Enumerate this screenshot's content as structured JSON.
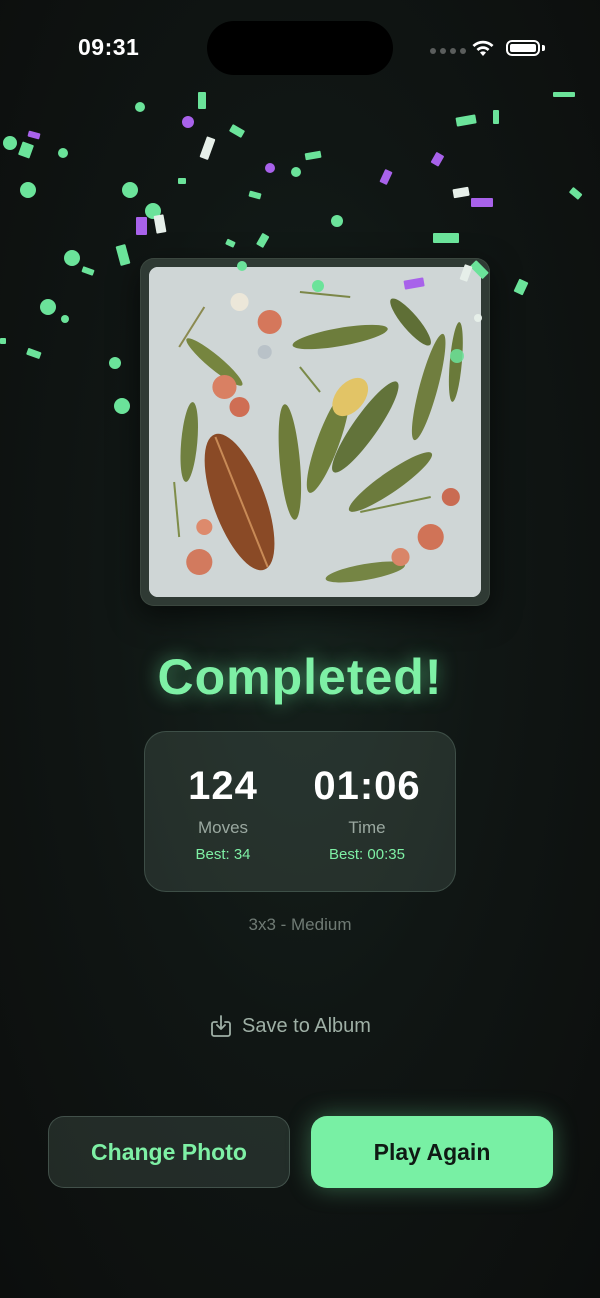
{
  "status_bar": {
    "time": "09:31"
  },
  "puzzle": {
    "image_description_icon": "pressed-botanicals-photo"
  },
  "result": {
    "title": "Completed!",
    "moves": {
      "value": "124",
      "label": "Moves",
      "best": "Best: 34"
    },
    "time": {
      "value": "01:06",
      "label": "Time",
      "best": "Best: 00:35"
    },
    "difficulty": "3x3 - Medium"
  },
  "actions": {
    "save_label": "Save to Album",
    "change_photo_label": "Change Photo",
    "play_again_label": "Play Again"
  },
  "colors": {
    "accent": "#78f0a4",
    "confetti_green": "#6be39a",
    "confetti_purple": "#a862ea",
    "background": "#101614"
  }
}
